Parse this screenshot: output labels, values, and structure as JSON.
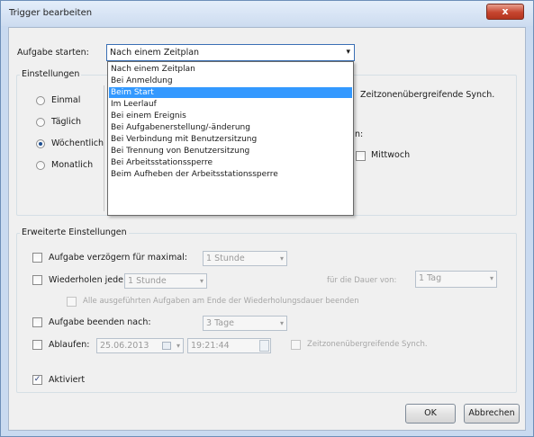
{
  "window": {
    "title": "Trigger bearbeiten",
    "close_glyph": "x"
  },
  "task_start": {
    "label": "Aufgabe starten:",
    "selected": "Nach einem Zeitplan",
    "arrow": "▾",
    "options": [
      "Nach einem Zeitplan",
      "Bei Anmeldung",
      "Beim Start",
      "Im Leerlauf",
      "Bei einem Ereignis",
      "Bei Aufgabenerstellung/-änderung",
      "Bei Verbindung mit Benutzersitzung",
      "Bei Trennung von Benutzersitzung",
      "Bei Arbeitsstationssperre",
      "Beim Aufheben der Arbeitsstationssperre"
    ],
    "highlighted_index": 2
  },
  "settings": {
    "title": "Einstellungen",
    "radios": [
      {
        "label": "Einmal",
        "checked": false
      },
      {
        "label": "Täglich",
        "checked": false
      },
      {
        "label": "Wöchentlich",
        "checked": true
      },
      {
        "label": "Monatlich",
        "checked": false
      }
    ],
    "sync_label": "Zeitzonenübergreifende Synch.",
    "colon_fragment": "n:",
    "weekday_wednesday": "Mittwoch"
  },
  "advanced": {
    "title": "Erweiterte Einstellungen",
    "delay": {
      "label": "Aufgabe verzögern für maximal:",
      "value": "1 Stunde",
      "checked": false
    },
    "repeat": {
      "label": "Wiederholen jede:",
      "value": "1 Stunde",
      "checked": false,
      "duration_label": "für die Dauer von:",
      "duration_value": "1 Tag"
    },
    "stop_all": {
      "label": "Alle ausgeführten Aufgaben am Ende der Wiederholungsdauer beenden",
      "checked": false
    },
    "stop_after": {
      "label": "Aufgabe beenden nach:",
      "value": "3 Tage",
      "checked": false
    },
    "expire": {
      "label": "Ablaufen:",
      "date": "25.06.2013",
      "time": "19:21:44",
      "checked": false,
      "sync_label": "Zeitzonenübergreifende Synch."
    },
    "enabled": {
      "label": "Aktiviert",
      "checked": true
    }
  },
  "buttons": {
    "ok": "OK",
    "cancel": "Abbrechen"
  },
  "icons": {
    "calendar": "calendar-icon",
    "spin": "spin-icon",
    "dropdown_arrow": "chevron-down-icon"
  }
}
